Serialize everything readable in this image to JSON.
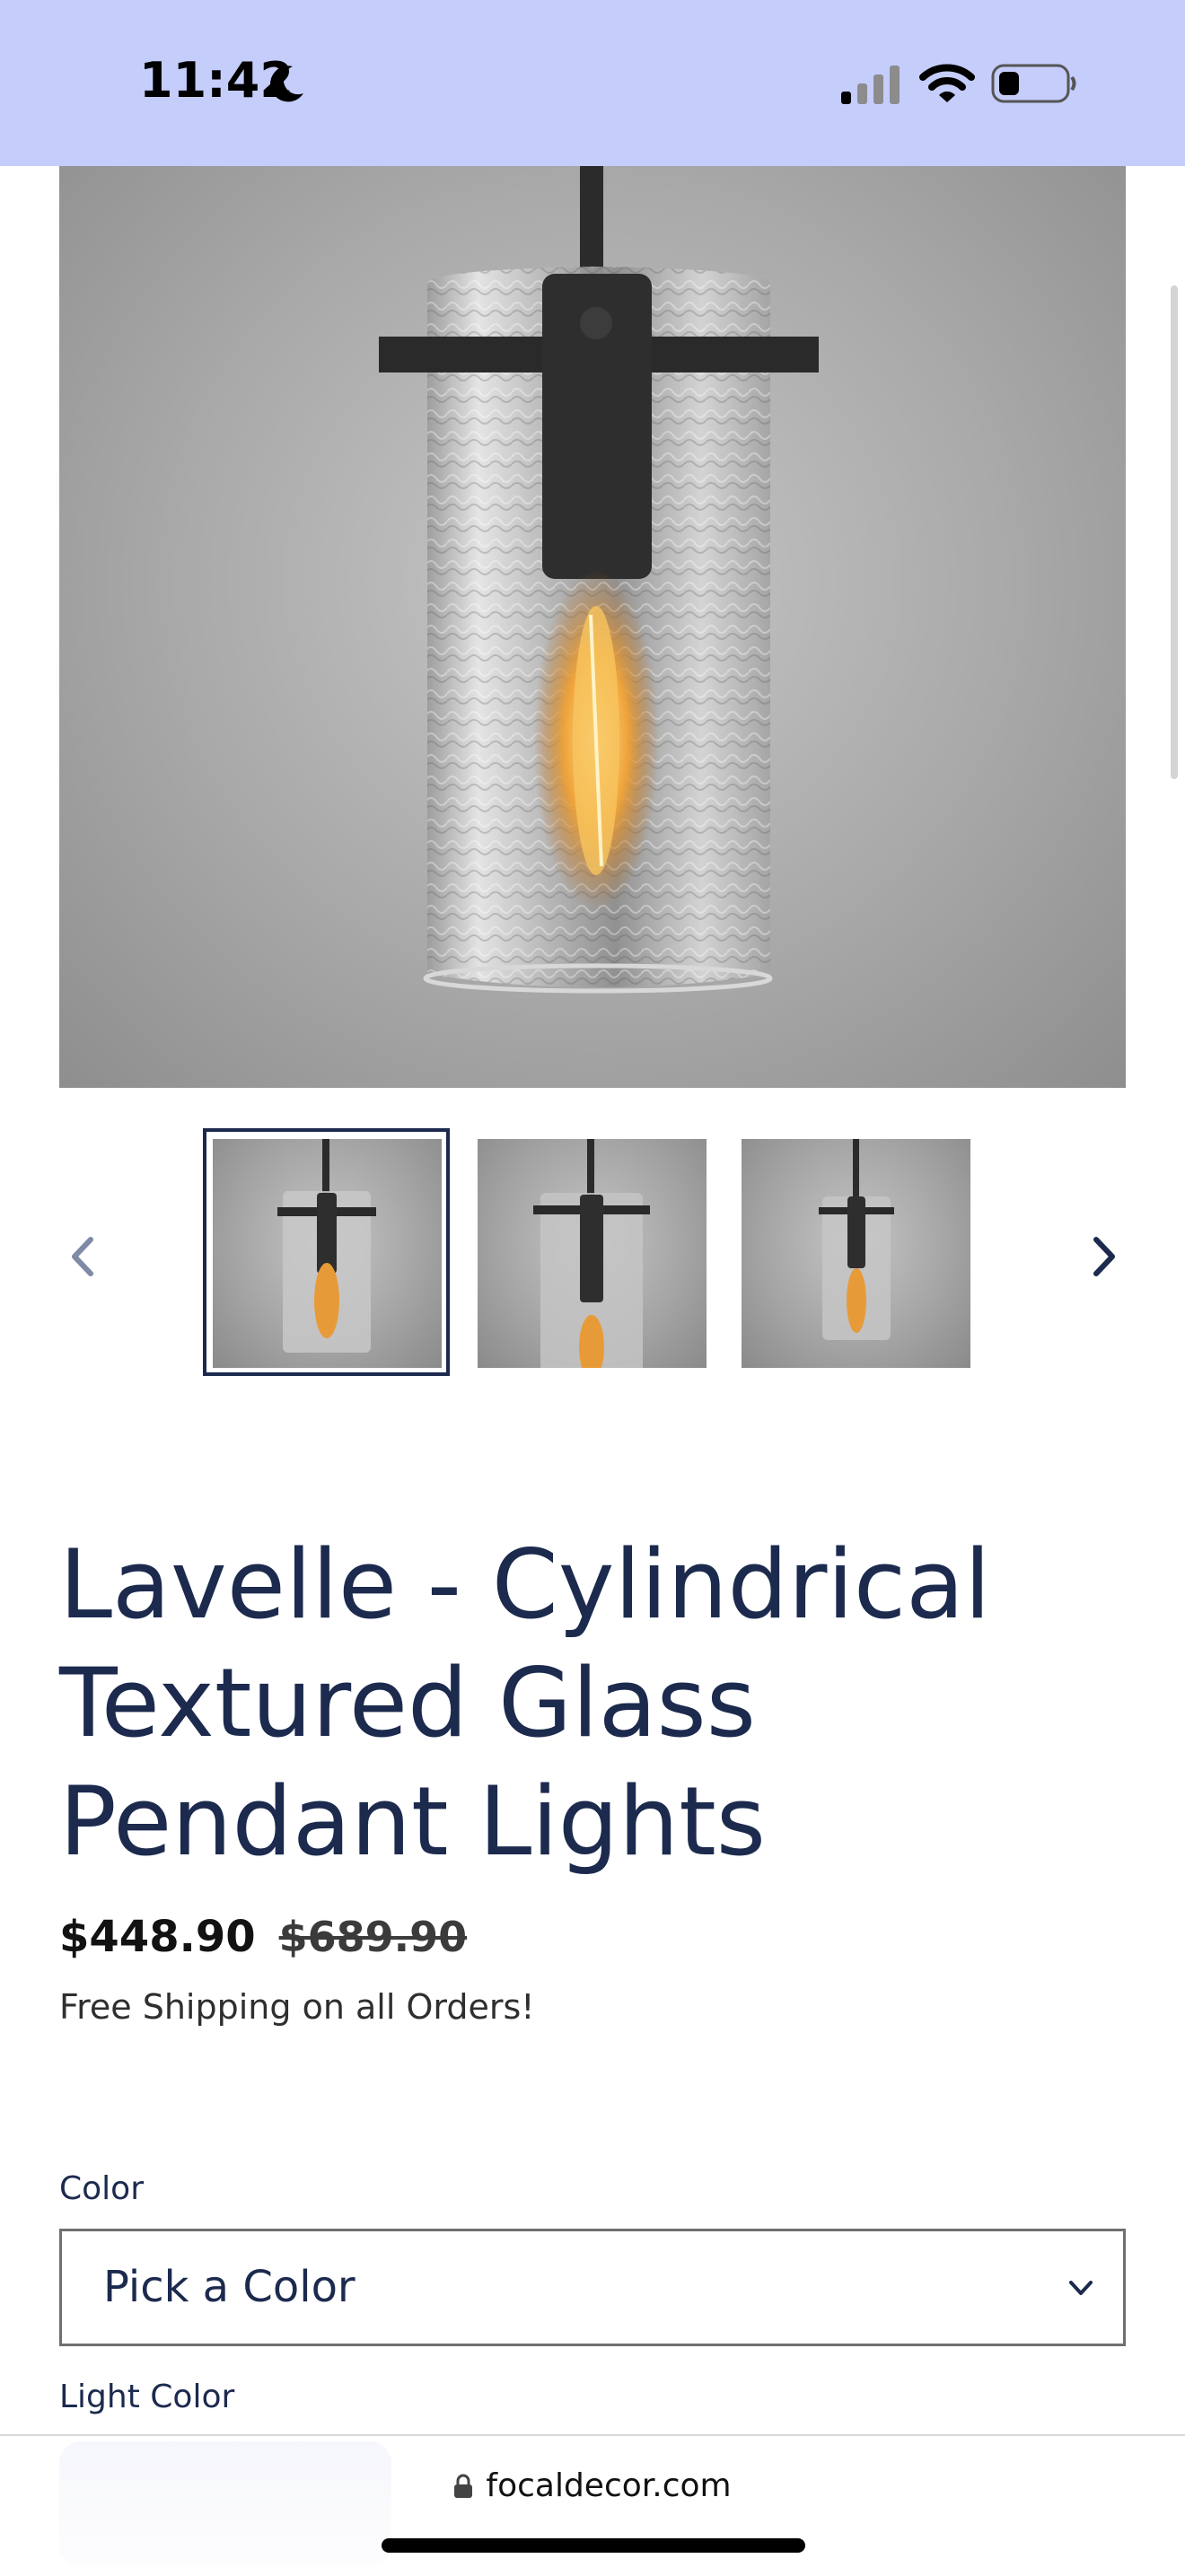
{
  "status_bar": {
    "time": "11:42",
    "moon_icon": "moon-icon",
    "signal_icon": "cellular-signal-icon",
    "wifi_icon": "wifi-icon",
    "battery_icon": "battery-icon",
    "background_color": "#c5cdfb"
  },
  "gallery": {
    "main_image_alt": "pendant-lamp-photo",
    "prev_icon": "chevron-left-icon",
    "next_icon": "chevron-right-icon",
    "thumbnails": [
      "thumb-1",
      "thumb-2",
      "thumb-3"
    ],
    "selected_index": 0
  },
  "product": {
    "title": "Lavelle - Cylindrical Textured Glass Pendant Lights",
    "price": "$448.90",
    "compare_at_price": "$689.90",
    "shipping_note": "Free Shipping on all Orders!"
  },
  "options": {
    "color_label": "Color",
    "color_value": "Pick a Color",
    "light_color_label": "Light Color"
  },
  "browser": {
    "url": "focaldecor.com"
  },
  "colors": {
    "accent": "#1c2a4e",
    "status_bar": "#c5cdfb"
  }
}
